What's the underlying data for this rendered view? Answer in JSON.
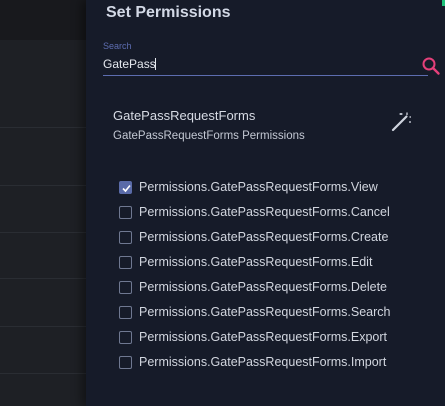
{
  "panel": {
    "title": "Set Permissions"
  },
  "search": {
    "label": "Search",
    "value": "GatePass",
    "icon": "search-icon"
  },
  "group": {
    "title": "GatePassRequestForms",
    "subtitle": "GatePassRequestForms Permissions",
    "action_icon": "magic-wand-icon"
  },
  "permissions": [
    {
      "label": "Permissions.GatePassRequestForms.View",
      "checked": true
    },
    {
      "label": "Permissions.GatePassRequestForms.Cancel",
      "checked": false
    },
    {
      "label": "Permissions.GatePassRequestForms.Create",
      "checked": false
    },
    {
      "label": "Permissions.GatePassRequestForms.Edit",
      "checked": false
    },
    {
      "label": "Permissions.GatePassRequestForms.Delete",
      "checked": false
    },
    {
      "label": "Permissions.GatePassRequestForms.Search",
      "checked": false
    },
    {
      "label": "Permissions.GatePassRequestForms.Export",
      "checked": false
    },
    {
      "label": "Permissions.GatePassRequestForms.Import",
      "checked": false
    }
  ],
  "colors": {
    "panel_bg": "#161b29",
    "accent": "#5d6db0",
    "search_icon": "#e5407a",
    "corner_accent": "#1ec27a"
  }
}
